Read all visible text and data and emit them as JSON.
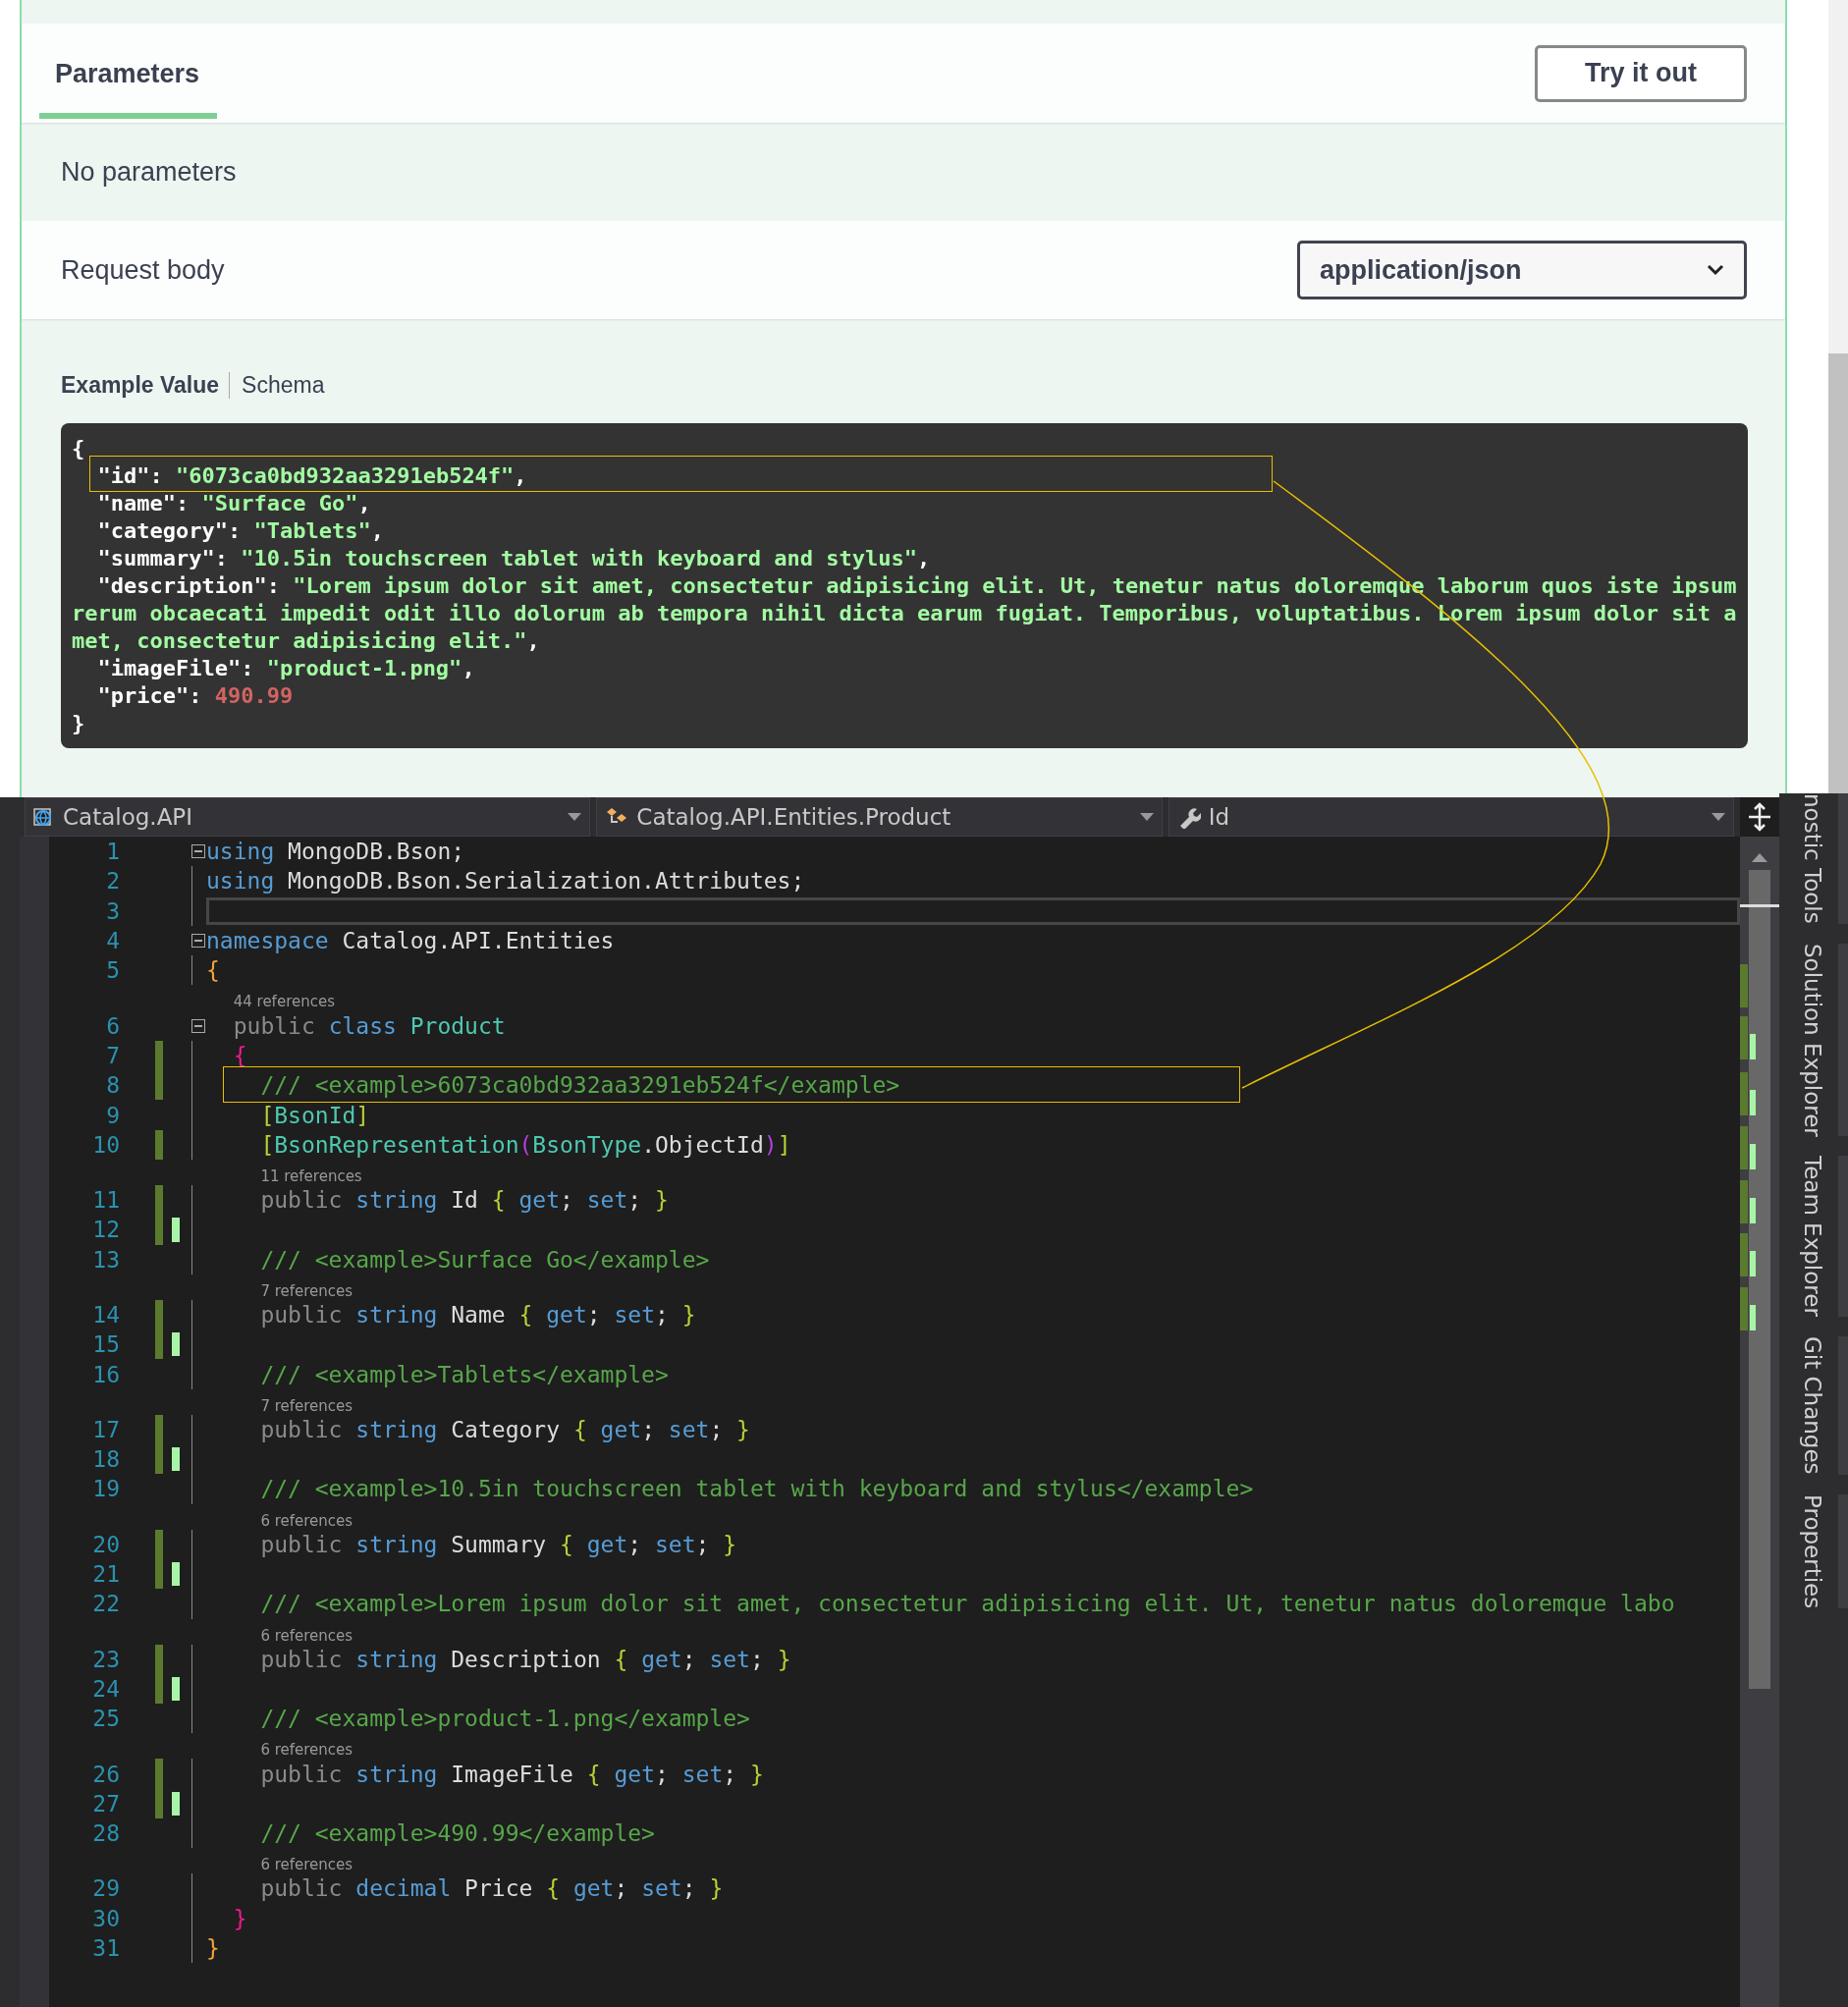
{
  "swagger": {
    "tab": {
      "label": "Parameters",
      "selected": true
    },
    "try_button": "Try it out",
    "no_params": "No parameters",
    "request_body": {
      "label": "Request body",
      "media_type": "application/json"
    },
    "example_tabs": [
      {
        "label": "Example Value",
        "selected": true
      },
      {
        "label": "Schema",
        "selected": false
      }
    ],
    "example_lines": [
      {
        "highlighted": false,
        "parts": [
          {
            "text": "{",
            "kind": "punct"
          }
        ]
      },
      {
        "highlighted": true,
        "parts": [
          {
            "text": "  \"id\": ",
            "kind": "key"
          },
          {
            "text": "\"6073ca0bd932aa3291eb524f\"",
            "kind": "string"
          },
          {
            "text": ",",
            "kind": "punct"
          }
        ]
      },
      {
        "highlighted": false,
        "parts": [
          {
            "text": "  \"name\": ",
            "kind": "key"
          },
          {
            "text": "\"Surface Go\"",
            "kind": "string"
          },
          {
            "text": ",",
            "kind": "punct"
          }
        ]
      },
      {
        "highlighted": false,
        "parts": [
          {
            "text": "  \"category\": ",
            "kind": "key"
          },
          {
            "text": "\"Tablets\"",
            "kind": "string"
          },
          {
            "text": ",",
            "kind": "punct"
          }
        ]
      },
      {
        "highlighted": false,
        "parts": [
          {
            "text": "  \"summary\": ",
            "kind": "key"
          },
          {
            "text": "\"10.5in touchscreen tablet with keyboard and stylus\"",
            "kind": "string"
          },
          {
            "text": ",",
            "kind": "punct"
          }
        ]
      },
      {
        "highlighted": false,
        "parts": [
          {
            "text": "  \"description\": ",
            "kind": "key"
          },
          {
            "text": "\"Lorem ipsum dolor sit amet, consectetur adipisicing elit. Ut, tenetur natus doloremque laborum quos iste ipsum rerum obcaecati impedit odit illo dolorum ab tempora nihil dicta earum fugiat. Temporibus, voluptatibus. Lorem ipsum dolor sit amet, consectetur adipisicing elit.\"",
            "kind": "string"
          },
          {
            "text": ",",
            "kind": "punct"
          }
        ]
      },
      {
        "highlighted": false,
        "parts": [
          {
            "text": "  \"imageFile\": ",
            "kind": "key"
          },
          {
            "text": "\"product-1.png\"",
            "kind": "string"
          },
          {
            "text": ",",
            "kind": "punct"
          }
        ]
      },
      {
        "highlighted": false,
        "parts": [
          {
            "text": "  \"price\": ",
            "kind": "key"
          },
          {
            "text": "490.99",
            "kind": "number"
          }
        ]
      },
      {
        "highlighted": false,
        "parts": [
          {
            "text": "}",
            "kind": "punct"
          }
        ]
      }
    ]
  },
  "editor": {
    "dropdowns": [
      {
        "label": "Catalog.API",
        "kind": "project"
      },
      {
        "label": "Catalog.API.Entities.Product",
        "kind": "class"
      },
      {
        "label": "Id",
        "kind": "property"
      }
    ],
    "lines": [
      {
        "number": "1",
        "fold": true,
        "current": false,
        "changed": false,
        "pending": false,
        "highlighted": false,
        "tokens": [
          {
            "text": "using",
            "kind": "kw"
          },
          {
            "text": " MongoDB.Bson;",
            "kind": "text"
          }
        ]
      },
      {
        "number": "2",
        "fold": false,
        "current": false,
        "changed": false,
        "pending": false,
        "highlighted": false,
        "tokens": [
          {
            "text": "using",
            "kind": "kw"
          },
          {
            "text": " MongoDB.Bson.Serialization.Attributes;",
            "kind": "text"
          }
        ]
      },
      {
        "number": "3",
        "fold": false,
        "current": true,
        "changed": false,
        "pending": false,
        "highlighted": false
      },
      {
        "number": "4",
        "fold": true,
        "current": false,
        "changed": false,
        "pending": false,
        "highlighted": false,
        "tokens": [
          {
            "text": "namespace",
            "kind": "kw"
          },
          {
            "text": " Catalog.API.Entities",
            "kind": "text"
          }
        ]
      },
      {
        "number": "5",
        "fold": false,
        "current": false,
        "changed": false,
        "pending": false,
        "highlighted": false,
        "tokens": [
          {
            "text": "{",
            "kind": "brace-gold"
          }
        ]
      },
      {
        "number": "6",
        "fold": true,
        "current": false,
        "changed": false,
        "pending": false,
        "highlighted": false,
        "codelens": "44 references",
        "tokens": [
          {
            "text": "  public ",
            "kind": "mod"
          },
          {
            "text": "class",
            "kind": "kw"
          },
          {
            "text": " Product",
            "kind": "type"
          }
        ]
      },
      {
        "number": "7",
        "fold": false,
        "current": false,
        "changed": true,
        "pending": false,
        "highlighted": false,
        "tokens": [
          {
            "text": "  {",
            "kind": "brace-pink"
          }
        ]
      },
      {
        "number": "8",
        "fold": false,
        "current": false,
        "changed": true,
        "pending": false,
        "highlighted": true,
        "tokens": [
          {
            "text": "    /// <example>6073ca0bd932aa3291eb524f</example>",
            "kind": "comment"
          }
        ]
      },
      {
        "number": "9",
        "fold": false,
        "current": false,
        "changed": false,
        "pending": false,
        "highlighted": false,
        "tokens": [
          {
            "text": "    [",
            "kind": "brace-lime"
          },
          {
            "text": "BsonId",
            "kind": "type"
          },
          {
            "text": "]",
            "kind": "brace-lime"
          }
        ]
      },
      {
        "number": "10",
        "fold": false,
        "current": false,
        "changed": true,
        "pending": false,
        "highlighted": false,
        "tokens": [
          {
            "text": "    [",
            "kind": "brace-lime"
          },
          {
            "text": "BsonRepresentation",
            "kind": "type"
          },
          {
            "text": "(",
            "kind": "brace-purple"
          },
          {
            "text": "BsonType",
            "kind": "type"
          },
          {
            "text": ".ObjectId",
            "kind": "text"
          },
          {
            "text": ")",
            "kind": "brace-purple"
          },
          {
            "text": "]",
            "kind": "brace-lime"
          }
        ]
      },
      {
        "number": "11",
        "fold": false,
        "current": false,
        "changed": true,
        "pending": false,
        "highlighted": false,
        "codelens": "11 references",
        "tokens": [
          {
            "text": "    public ",
            "kind": "mod"
          },
          {
            "text": "string",
            "kind": "kw"
          },
          {
            "text": " Id ",
            "kind": "text"
          },
          {
            "text": "{",
            "kind": "brace-lime"
          },
          {
            "text": " get",
            "kind": "kw"
          },
          {
            "text": "; ",
            "kind": "text"
          },
          {
            "text": "set",
            "kind": "kw"
          },
          {
            "text": "; ",
            "kind": "text"
          },
          {
            "text": "}",
            "kind": "brace-lime"
          }
        ]
      },
      {
        "number": "12",
        "fold": false,
        "current": false,
        "changed": true,
        "pending": true,
        "highlighted": false
      },
      {
        "number": "13",
        "fold": false,
        "current": false,
        "changed": false,
        "pending": false,
        "highlighted": false,
        "tokens": [
          {
            "text": "    /// <example>Surface Go</example>",
            "kind": "comment"
          }
        ]
      },
      {
        "number": "14",
        "fold": false,
        "current": false,
        "changed": true,
        "pending": false,
        "highlighted": false,
        "codelens": "7 references",
        "tokens": [
          {
            "text": "    public ",
            "kind": "mod"
          },
          {
            "text": "string",
            "kind": "kw"
          },
          {
            "text": " Name ",
            "kind": "text"
          },
          {
            "text": "{",
            "kind": "brace-lime"
          },
          {
            "text": " get",
            "kind": "kw"
          },
          {
            "text": "; ",
            "kind": "text"
          },
          {
            "text": "set",
            "kind": "kw"
          },
          {
            "text": "; ",
            "kind": "text"
          },
          {
            "text": "}",
            "kind": "brace-lime"
          }
        ]
      },
      {
        "number": "15",
        "fold": false,
        "current": false,
        "changed": true,
        "pending": true,
        "highlighted": false
      },
      {
        "number": "16",
        "fold": false,
        "current": false,
        "changed": false,
        "pending": false,
        "highlighted": false,
        "tokens": [
          {
            "text": "    /// <example>Tablets</example>",
            "kind": "comment"
          }
        ]
      },
      {
        "number": "17",
        "fold": false,
        "current": false,
        "changed": true,
        "pending": false,
        "highlighted": false,
        "codelens": "7 references",
        "tokens": [
          {
            "text": "    public ",
            "kind": "mod"
          },
          {
            "text": "string",
            "kind": "kw"
          },
          {
            "text": " Category ",
            "kind": "text"
          },
          {
            "text": "{",
            "kind": "brace-lime"
          },
          {
            "text": " get",
            "kind": "kw"
          },
          {
            "text": "; ",
            "kind": "text"
          },
          {
            "text": "set",
            "kind": "kw"
          },
          {
            "text": "; ",
            "kind": "text"
          },
          {
            "text": "}",
            "kind": "brace-lime"
          }
        ]
      },
      {
        "number": "18",
        "fold": false,
        "current": false,
        "changed": true,
        "pending": true,
        "highlighted": false
      },
      {
        "number": "19",
        "fold": false,
        "current": false,
        "changed": false,
        "pending": false,
        "highlighted": false,
        "tokens": [
          {
            "text": "    /// <example>10.5in touchscreen tablet with keyboard and stylus</example>",
            "kind": "comment"
          }
        ]
      },
      {
        "number": "20",
        "fold": false,
        "current": false,
        "changed": true,
        "pending": false,
        "highlighted": false,
        "codelens": "6 references",
        "tokens": [
          {
            "text": "    public ",
            "kind": "mod"
          },
          {
            "text": "string",
            "kind": "kw"
          },
          {
            "text": " Summary ",
            "kind": "text"
          },
          {
            "text": "{",
            "kind": "brace-lime"
          },
          {
            "text": " get",
            "kind": "kw"
          },
          {
            "text": "; ",
            "kind": "text"
          },
          {
            "text": "set",
            "kind": "kw"
          },
          {
            "text": "; ",
            "kind": "text"
          },
          {
            "text": "}",
            "kind": "brace-lime"
          }
        ]
      },
      {
        "number": "21",
        "fold": false,
        "current": false,
        "changed": true,
        "pending": true,
        "highlighted": false
      },
      {
        "number": "22",
        "fold": false,
        "current": false,
        "changed": false,
        "pending": false,
        "highlighted": false,
        "tokens": [
          {
            "text": "    /// <example>Lorem ipsum dolor sit amet, consectetur adipisicing elit. Ut, tenetur natus doloremque labo",
            "kind": "comment"
          }
        ]
      },
      {
        "number": "23",
        "fold": false,
        "current": false,
        "changed": true,
        "pending": false,
        "highlighted": false,
        "codelens": "6 references",
        "tokens": [
          {
            "text": "    public ",
            "kind": "mod"
          },
          {
            "text": "string",
            "kind": "kw"
          },
          {
            "text": " Description ",
            "kind": "text"
          },
          {
            "text": "{",
            "kind": "brace-lime"
          },
          {
            "text": " get",
            "kind": "kw"
          },
          {
            "text": "; ",
            "kind": "text"
          },
          {
            "text": "set",
            "kind": "kw"
          },
          {
            "text": "; ",
            "kind": "text"
          },
          {
            "text": "}",
            "kind": "brace-lime"
          }
        ]
      },
      {
        "number": "24",
        "fold": false,
        "current": false,
        "changed": true,
        "pending": true,
        "highlighted": false
      },
      {
        "number": "25",
        "fold": false,
        "current": false,
        "changed": false,
        "pending": false,
        "highlighted": false,
        "tokens": [
          {
            "text": "    /// <example>product-1.png</example>",
            "kind": "comment"
          }
        ]
      },
      {
        "number": "26",
        "fold": false,
        "current": false,
        "changed": true,
        "pending": false,
        "highlighted": false,
        "codelens": "6 references",
        "tokens": [
          {
            "text": "    public ",
            "kind": "mod"
          },
          {
            "text": "string",
            "kind": "kw"
          },
          {
            "text": " ImageFile ",
            "kind": "text"
          },
          {
            "text": "{",
            "kind": "brace-lime"
          },
          {
            "text": " get",
            "kind": "kw"
          },
          {
            "text": "; ",
            "kind": "text"
          },
          {
            "text": "set",
            "kind": "kw"
          },
          {
            "text": "; ",
            "kind": "text"
          },
          {
            "text": "}",
            "kind": "brace-lime"
          }
        ]
      },
      {
        "number": "27",
        "fold": false,
        "current": false,
        "changed": true,
        "pending": true,
        "highlighted": false
      },
      {
        "number": "28",
        "fold": false,
        "current": false,
        "changed": false,
        "pending": false,
        "highlighted": false,
        "tokens": [
          {
            "text": "    /// <example>490.99</example>",
            "kind": "comment"
          }
        ]
      },
      {
        "number": "29",
        "fold": false,
        "current": false,
        "changed": false,
        "pending": false,
        "highlighted": false,
        "codelens": "6 references",
        "tokens": [
          {
            "text": "    public ",
            "kind": "mod"
          },
          {
            "text": "decimal",
            "kind": "kw"
          },
          {
            "text": " Price ",
            "kind": "text"
          },
          {
            "text": "{",
            "kind": "brace-lime"
          },
          {
            "text": " get",
            "kind": "kw"
          },
          {
            "text": "; ",
            "kind": "text"
          },
          {
            "text": "set",
            "kind": "kw"
          },
          {
            "text": "; ",
            "kind": "text"
          },
          {
            "text": "}",
            "kind": "brace-lime"
          }
        ]
      },
      {
        "number": "30",
        "fold": false,
        "current": false,
        "changed": false,
        "pending": false,
        "highlighted": false,
        "tokens": [
          {
            "text": "  }",
            "kind": "brace-pink"
          }
        ]
      },
      {
        "number": "31",
        "fold": false,
        "current": false,
        "changed": false,
        "pending": false,
        "highlighted": false,
        "tokens": [
          {
            "text": "}",
            "kind": "brace-gold"
          }
        ]
      }
    ]
  },
  "tool_tabs": [
    "nostic Tools",
    "Solution Explorer",
    "Team Explorer",
    "Git Changes",
    "Properties"
  ]
}
